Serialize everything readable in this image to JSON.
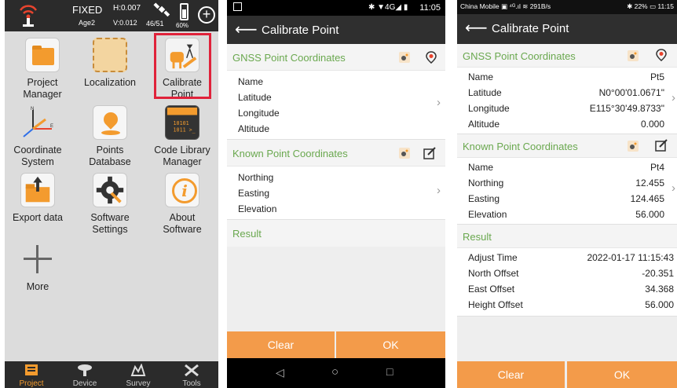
{
  "screen1": {
    "status": {
      "fix": "FIXED",
      "age": "Age2",
      "h_precision": "H:0.007",
      "v_precision": "V:0.012",
      "satellites": "46/51",
      "battery": "60%"
    },
    "grid": [
      {
        "label": "Project\nManager",
        "icon": "folder-icon"
      },
      {
        "label": "Localization",
        "icon": "map-icon"
      },
      {
        "label": "Calibrate\nPoint",
        "icon": "calibrate-point-icon"
      },
      {
        "label": "Coordinate\nSystem",
        "icon": "coordinate-axes-icon"
      },
      {
        "label": "Points\nDatabase",
        "icon": "map-pin-icon"
      },
      {
        "label": "Code Library\nManager",
        "icon": "code-terminal-icon"
      },
      {
        "label": "Export data",
        "icon": "export-folder-icon"
      },
      {
        "label": "Software\nSettings",
        "icon": "gear-icon"
      },
      {
        "label": "About\nSoftware",
        "icon": "info-icon"
      },
      {
        "label": "More",
        "icon": "plus-icon"
      }
    ],
    "nav": [
      {
        "label": "Project",
        "icon": "project-icon",
        "active": true
      },
      {
        "label": "Device",
        "icon": "device-icon",
        "active": false
      },
      {
        "label": "Survey",
        "icon": "survey-icon",
        "active": false
      },
      {
        "label": "Tools",
        "icon": "tools-icon",
        "active": false
      }
    ]
  },
  "screen2": {
    "status_bar": {
      "icons": "✱ ▼4G◢ ▮",
      "time": "11:05"
    },
    "title": "Calibrate Point",
    "gnss_section": "GNSS Point Coordinates",
    "gnss_rows": [
      {
        "label": "Name",
        "value": ""
      },
      {
        "label": "Latitude",
        "value": ""
      },
      {
        "label": "Longitude",
        "value": ""
      },
      {
        "label": "Altitude",
        "value": ""
      }
    ],
    "known_section": "Known Point Coordinates",
    "known_rows": [
      {
        "label": "Northing",
        "value": ""
      },
      {
        "label": "Easting",
        "value": ""
      },
      {
        "label": "Elevation",
        "value": ""
      }
    ],
    "result_section": "Result",
    "clear_label": "Clear",
    "ok_label": "OK"
  },
  "screen3": {
    "status_bar": {
      "left": "China Mobile ▣ ⁴ᴳ.ıl ≋ 291B/s",
      "right": "✱ 22% ▭ 11:15"
    },
    "title": "Calibrate Point",
    "gnss_section": "GNSS Point Coordinates",
    "gnss_rows": [
      {
        "label": "Name",
        "value": "Pt5"
      },
      {
        "label": "Latitude",
        "value": "N0°00'01.0671\""
      },
      {
        "label": "Longitude",
        "value": "E115°30'49.8733\""
      },
      {
        "label": "Altitude",
        "value": "0.000"
      }
    ],
    "known_section": "Known Point Coordinates",
    "known_rows": [
      {
        "label": "Name",
        "value": "Pt4"
      },
      {
        "label": "Northing",
        "value": "12.455"
      },
      {
        "label": "Easting",
        "value": "124.465"
      },
      {
        "label": "Elevation",
        "value": "56.000"
      }
    ],
    "result_section": "Result",
    "result_rows": [
      {
        "label": "Adjust Time",
        "value": "2022-01-17 11:15:43"
      },
      {
        "label": "North Offset",
        "value": "-20.351"
      },
      {
        "label": "East Offset",
        "value": "34.368"
      },
      {
        "label": "Height Offset",
        "value": "56.000"
      }
    ],
    "clear_label": "Clear",
    "ok_label": "OK"
  },
  "colors": {
    "accent": "#f39b4a",
    "section_text": "#6aa84f",
    "highlight": "#e0223a",
    "header": "#2f2f2f"
  }
}
